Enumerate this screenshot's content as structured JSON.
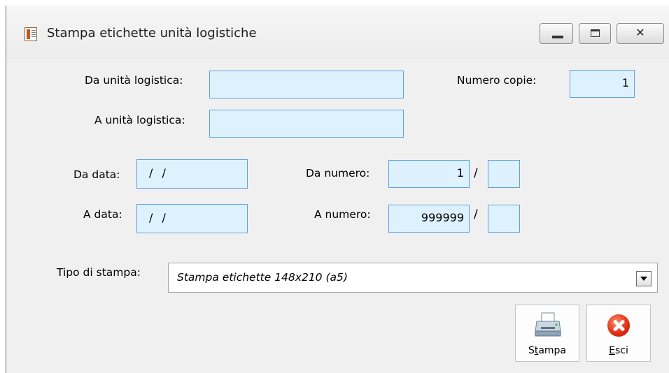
{
  "window": {
    "title": "Stampa etichette unità logistiche"
  },
  "form": {
    "da_unita_label": "Da unità logistica:",
    "da_unita_value": "",
    "a_unita_label": "A unità logistica:",
    "a_unita_value": "",
    "numero_copie_label": "Numero copie:",
    "numero_copie_value": "1",
    "da_data_label": "Da data:",
    "da_data_value": "/ /",
    "a_data_label": "A data:",
    "a_data_value": "/ /",
    "da_numero_label": "Da numero:",
    "da_numero_value": "1",
    "da_numero_suffix": "",
    "a_numero_label": "A numero:",
    "a_numero_value": "999999",
    "a_numero_suffix": "",
    "separator": "/",
    "tipo_stampa_label": "Tipo di stampa:",
    "tipo_stampa_selected": "Stampa etichette 148x210 (a5)"
  },
  "buttons": {
    "stampa_pre": "S",
    "stampa_accel": "t",
    "stampa_post": "ampa",
    "esci_accel": "E",
    "esci_post": "sci"
  },
  "icons": {
    "app": "report-icon",
    "stampa": "printer-icon",
    "esci": "close-circle-icon"
  }
}
